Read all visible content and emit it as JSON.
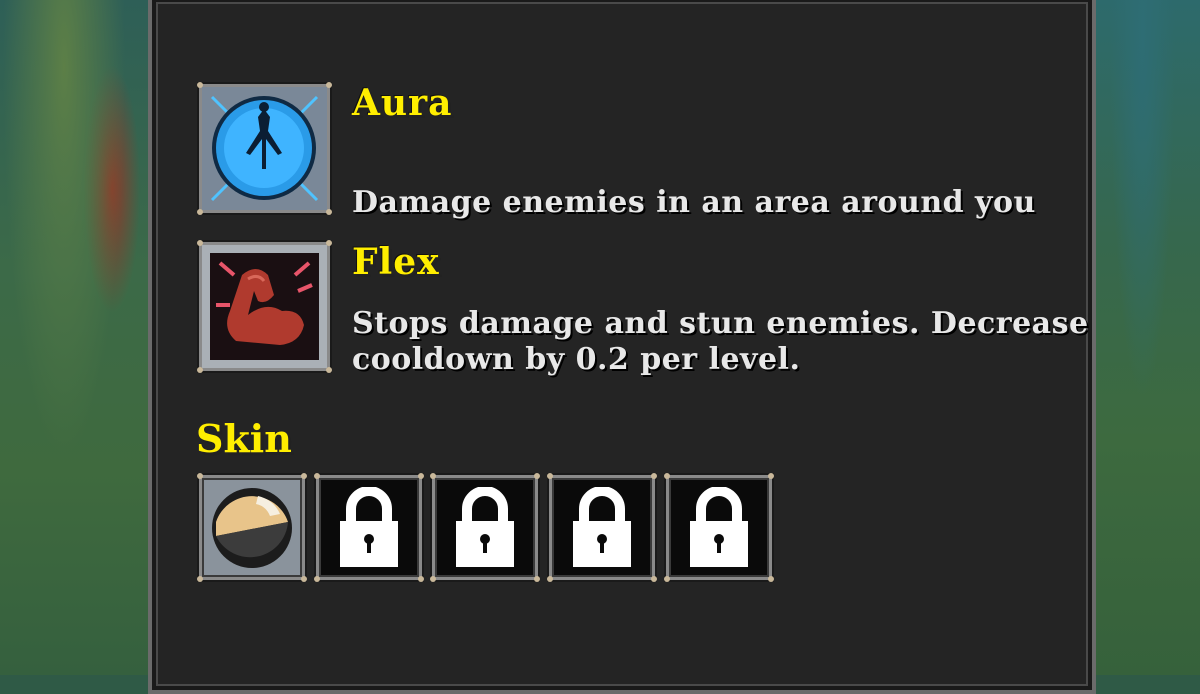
{
  "abilities": [
    {
      "title": "Aura",
      "description": "Damage enemies in an area around you",
      "icon": "aura-icon"
    },
    {
      "title": "Flex",
      "description_line1": "Stops damage and stun enemies. Decrease",
      "description_line2": "cooldown by 0.2 per level.",
      "icon": "flex-icon"
    }
  ],
  "skin": {
    "title": "Skin",
    "slots": [
      {
        "icon": "skin-ball-icon",
        "locked": false
      },
      {
        "icon": "lock-icon",
        "locked": true
      },
      {
        "icon": "lock-icon",
        "locked": true
      },
      {
        "icon": "lock-icon",
        "locked": true
      },
      {
        "icon": "lock-icon",
        "locked": true
      }
    ]
  },
  "colors": {
    "title": "#ffee00",
    "text": "#e8e8e8",
    "panel": "#242424"
  }
}
